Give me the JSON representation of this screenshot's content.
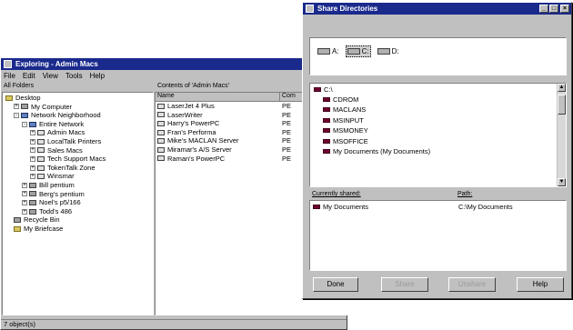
{
  "explorer": {
    "title": "Exploring - Admin Macs",
    "menu": [
      "File",
      "Edit",
      "View",
      "Tools",
      "Help"
    ],
    "left_header": "All Folders",
    "right_header": "Contents of 'Admin Macs'",
    "columns": [
      "Name",
      "Com"
    ],
    "tree": [
      {
        "label": "Desktop",
        "icon": "desktop-icon",
        "depth": 0,
        "exp": ""
      },
      {
        "label": "My Computer",
        "icon": "computer-icon",
        "depth": 1,
        "exp": "+"
      },
      {
        "label": "Network Neighborhood",
        "icon": "network-icon",
        "depth": 1,
        "exp": "-"
      },
      {
        "label": "Entire Network",
        "icon": "network-icon",
        "depth": 2,
        "exp": "-"
      },
      {
        "label": "Admin Macs",
        "icon": "mac-group-icon",
        "depth": 3,
        "exp": "+"
      },
      {
        "label": "LocalTalk Printers",
        "icon": "mac-group-icon",
        "depth": 3,
        "exp": "+"
      },
      {
        "label": "Sales Macs",
        "icon": "mac-group-icon",
        "depth": 3,
        "exp": "+"
      },
      {
        "label": "Tech Support Macs",
        "icon": "mac-group-icon",
        "depth": 3,
        "exp": "+"
      },
      {
        "label": "TokenTalk Zone",
        "icon": "mac-group-icon",
        "depth": 3,
        "exp": "+"
      },
      {
        "label": "Winsmar",
        "icon": "mac-group-icon",
        "depth": 3,
        "exp": "+"
      },
      {
        "label": "Bill pentium",
        "icon": "computer-icon",
        "depth": 2,
        "exp": "+"
      },
      {
        "label": "Berg's pentium",
        "icon": "computer-icon",
        "depth": 2,
        "exp": "+"
      },
      {
        "label": "Noel's p5/166",
        "icon": "computer-icon",
        "depth": 2,
        "exp": "+"
      },
      {
        "label": "Todd's 486",
        "icon": "computer-icon",
        "depth": 2,
        "exp": "+"
      },
      {
        "label": "Recycle Bin",
        "icon": "recycle-bin-icon",
        "depth": 1,
        "exp": ""
      },
      {
        "label": "My Briefcase",
        "icon": "briefcase-icon",
        "depth": 1,
        "exp": ""
      }
    ],
    "contents": [
      {
        "name": "LaserJet 4 Plus",
        "com": "PE"
      },
      {
        "name": "LaserWriter",
        "com": "PE"
      },
      {
        "name": "Harry's PowerPC",
        "com": "PE"
      },
      {
        "name": "Fran's Performa",
        "com": "PE"
      },
      {
        "name": "Mike's MACLAN Server",
        "com": "PE"
      },
      {
        "name": "Miramar's A/S Server",
        "com": "PE"
      },
      {
        "name": "Raman's PowerPC",
        "com": "PE"
      }
    ],
    "status": "7 object(s)"
  },
  "share": {
    "title": "Share Directories",
    "drives": [
      {
        "label": "A:",
        "selected": false
      },
      {
        "label": "C:",
        "selected": true
      },
      {
        "label": "D:",
        "selected": false
      }
    ],
    "root": "C:\\",
    "dirs": [
      "CDROM",
      "MACLANS",
      "MSINPUT",
      "MSMONEY",
      "MSOFFICE",
      "My Documents (My Documents)"
    ],
    "shared_header": "Currently shared:",
    "path_header": "Path:",
    "shared": [
      {
        "name": "My Documents",
        "path": "C:\\My Documents"
      }
    ],
    "buttons": {
      "done": "Done",
      "share": "Share",
      "unshare": "Unshare",
      "help": "Help"
    }
  }
}
